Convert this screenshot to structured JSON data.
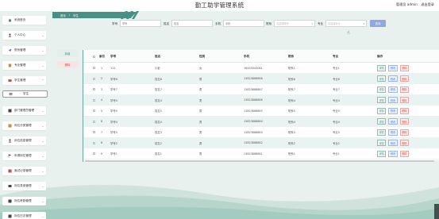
{
  "header": {
    "title": "勤工助学管理系统",
    "user_label": "管理员 admin",
    "logout_label": "退出登录"
  },
  "breadcrumb": {
    "home": "首页",
    "current": "学生"
  },
  "sidebar": {
    "items": [
      {
        "label": "系统首页",
        "icon": "home-icon"
      },
      {
        "label": "个人中心",
        "icon": "user-icon"
      },
      {
        "label": "院系管理",
        "icon": "send-icon"
      },
      {
        "label": "专业管理",
        "icon": "book-icon"
      },
      {
        "label": "学生管理",
        "icon": "student-icon"
      },
      {
        "label": "学生",
        "icon": "list-icon",
        "sub": true
      },
      {
        "label": "部门管理员管理",
        "icon": "dept-icon"
      },
      {
        "label": "岗位分类管理",
        "icon": "category-icon"
      },
      {
        "label": "岗位信息管理",
        "icon": "job-icon"
      },
      {
        "label": "申请岗位管理",
        "icon": "flag-icon"
      },
      {
        "label": "面试记录管理",
        "icon": "record-icon"
      },
      {
        "label": "岗位录用管理",
        "icon": "hire-icon"
      },
      {
        "label": "岗位考勤管理",
        "icon": "attendance-icon"
      },
      {
        "label": "岗位日志管理",
        "icon": "log-icon"
      }
    ]
  },
  "search": {
    "fields": [
      {
        "label": "学号",
        "placeholder": "学号"
      },
      {
        "label": "姓名",
        "placeholder": "姓名"
      },
      {
        "label": "手机",
        "placeholder": "手机"
      },
      {
        "label": "院系",
        "placeholder": "请选择院系",
        "select": true
      },
      {
        "label": "专业",
        "placeholder": "请选择专业",
        "select": true
      }
    ],
    "button": "查询"
  },
  "actions": {
    "add": "新增",
    "delete": "删除"
  },
  "table": {
    "headers": [
      "索引",
      "学号",
      "姓名",
      "性别",
      "手机",
      "院系",
      "专业",
      "操作"
    ],
    "ops": {
      "detail": "详情",
      "edit": "修改",
      "delete": "删除"
    },
    "rows": [
      {
        "index": "1",
        "xuehao": "111",
        "name": "小彭",
        "gender": "女",
        "phone": "16455043061",
        "dept": "院系1",
        "major": "专业1"
      },
      {
        "index": "2",
        "xuehao": "学号6",
        "name": "姓名6",
        "gender": "男",
        "phone": "13823888886",
        "dept": "院系6",
        "major": "专业6"
      },
      {
        "index": "3",
        "xuehao": "学号7",
        "name": "姓名7",
        "gender": "男",
        "phone": "13823888887",
        "dept": "院系7",
        "major": "专业7"
      },
      {
        "index": "4",
        "xuehao": "学号4",
        "name": "姓名4",
        "gender": "男",
        "phone": "13823888886",
        "dept": "院系4",
        "major": "专业4"
      },
      {
        "index": "5",
        "xuehao": "学号5",
        "name": "姓名5",
        "gender": "男",
        "phone": "13823888885",
        "dept": "院系5",
        "major": "专业5"
      },
      {
        "index": "6",
        "xuehao": "学号4",
        "name": "姓名4",
        "gender": "男",
        "phone": "13823888884",
        "dept": "院系4",
        "major": "专业4"
      },
      {
        "index": "7",
        "xuehao": "学号3",
        "name": "姓名3",
        "gender": "男",
        "phone": "13823888883",
        "dept": "院系3",
        "major": "专业3"
      },
      {
        "index": "8",
        "xuehao": "学号2",
        "name": "姓名2",
        "gender": "男",
        "phone": "13823888882",
        "dept": "院系2",
        "major": "专业2"
      },
      {
        "index": "9",
        "xuehao": "学号1",
        "name": "姓名1",
        "gender": "男",
        "phone": "13823888881",
        "dept": "院系1",
        "major": "专业1"
      }
    ]
  },
  "colors": {
    "accent": "#4a8f86",
    "search_button": "#8ea8e2",
    "delete": "#d0564f"
  }
}
